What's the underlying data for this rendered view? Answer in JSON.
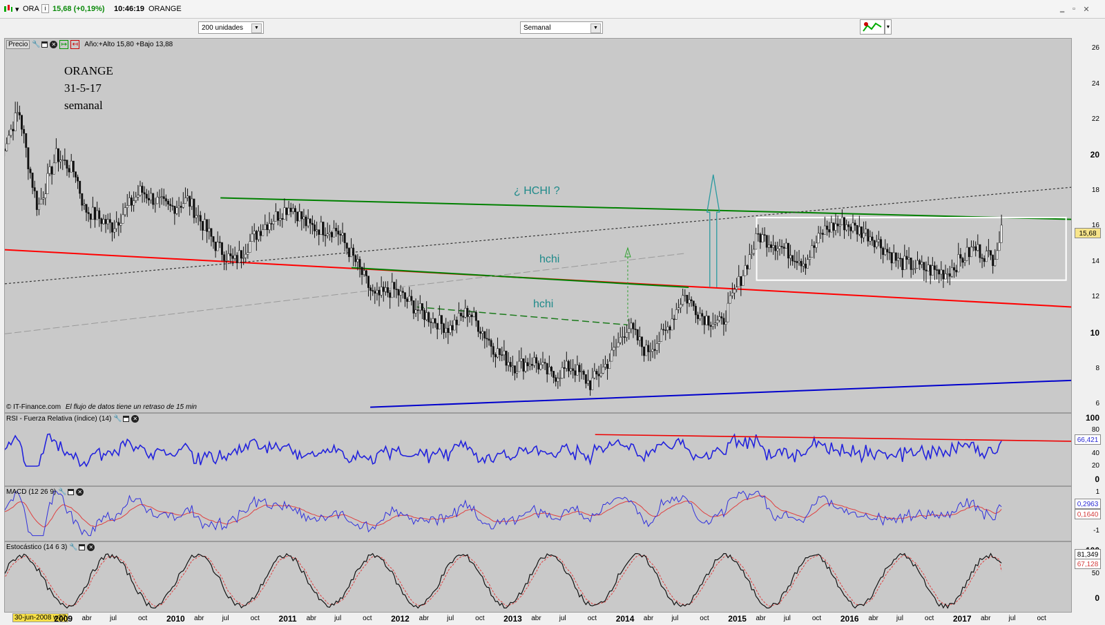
{
  "titlebar": {
    "symbol": "ORA",
    "info_icon": "i",
    "quote": "15,68 (+0,19%)",
    "time": "10:46:19",
    "name": "ORANGE",
    "quote_color": "#0b8a0b"
  },
  "toolbar": {
    "units_select": "200 unidades",
    "period_select": "Semanal"
  },
  "price_panel": {
    "label": "Precio",
    "year_info": "Año:+Alto 15,80 +Bajo 13,88",
    "note_lines": [
      "ORANGE",
      "31-5-17",
      "semanal"
    ],
    "annotations": {
      "hchi_question": "¿ HCHI ?",
      "hchi_upper": "hchi",
      "hchi_lower": "hchi"
    },
    "copyright": "© IT-Finance.com",
    "delay_note": "El flujo de datos tiene un retraso de 15 min",
    "axis_ticks": [
      "26",
      "24",
      "22",
      "20",
      "18",
      "16",
      "14",
      "12",
      "10",
      "8",
      "6"
    ],
    "current_price": "15,68"
  },
  "rsi_panel": {
    "label": "RSI - Fuerza Relativa (índice) (14)",
    "axis_ticks": [
      "100",
      "80",
      "60",
      "40",
      "20",
      "0"
    ],
    "current_value": "66,421"
  },
  "macd_panel": {
    "label": "MACD (12 26 9)",
    "axis_ticks": [
      "1",
      "0",
      "-1"
    ],
    "macd_value": "0,2963",
    "signal_value": "0,1640"
  },
  "stoch_panel": {
    "label": "Estocástico (14 6 3)",
    "axis_ticks": [
      "100",
      "50",
      "0"
    ],
    "k_value": "81,349",
    "d_value": "67,128"
  },
  "time_axis": {
    "cursor_date": "30-jun-2008 w27",
    "labels": [
      "2009",
      "abr",
      "jul",
      "oct",
      "2010",
      "abr",
      "jul",
      "oct",
      "2011",
      "abr",
      "jul",
      "oct",
      "2012",
      "abr",
      "jul",
      "oct",
      "2013",
      "abr",
      "jul",
      "oct",
      "2014",
      "abr",
      "jul",
      "oct",
      "2015",
      "abr",
      "jul",
      "oct",
      "2016",
      "abr",
      "jul",
      "oct",
      "2017",
      "abr",
      "jul",
      "oct"
    ]
  },
  "chart_data": {
    "type": "candlestick",
    "symbol": "ORANGE",
    "period": "semanal",
    "ylim": [
      6,
      26
    ],
    "x_range": [
      "2008-06-30",
      "2017-12-31"
    ],
    "price_path": [
      [
        "2008-06",
        20.0
      ],
      [
        "2008-08",
        22.5
      ],
      [
        "2008-09",
        19.5
      ],
      [
        "2008-10",
        17.0
      ],
      [
        "2008-12",
        20.0
      ],
      [
        "2009-02",
        19.0
      ],
      [
        "2009-03",
        17.0
      ],
      [
        "2009-06",
        16.0
      ],
      [
        "2009-09",
        18.0
      ],
      [
        "2009-12",
        17.0
      ],
      [
        "2010-02",
        17.5
      ],
      [
        "2010-05",
        15.0
      ],
      [
        "2010-07",
        14.0
      ],
      [
        "2010-10",
        16.0
      ],
      [
        "2011-01",
        17.2
      ],
      [
        "2011-03",
        16.0
      ],
      [
        "2011-06",
        15.8
      ],
      [
        "2011-08",
        14.0
      ],
      [
        "2011-10",
        12.0
      ],
      [
        "2011-12",
        12.5
      ],
      [
        "2012-03",
        11.2
      ],
      [
        "2012-06",
        10.3
      ],
      [
        "2012-08",
        11.3
      ],
      [
        "2012-11",
        9.0
      ],
      [
        "2013-01",
        8.2
      ],
      [
        "2013-03",
        8.5
      ],
      [
        "2013-05",
        7.6
      ],
      [
        "2013-07",
        8.2
      ],
      [
        "2013-09",
        7.2
      ],
      [
        "2013-11",
        8.5
      ],
      [
        "2014-01",
        10.5
      ],
      [
        "2014-03",
        9.0
      ],
      [
        "2014-05",
        10.0
      ],
      [
        "2014-07",
        12.2
      ],
      [
        "2014-09",
        11.0
      ],
      [
        "2014-11",
        10.5
      ],
      [
        "2015-01",
        13.0
      ],
      [
        "2015-03",
        15.5
      ],
      [
        "2015-05",
        15.0
      ],
      [
        "2015-08",
        14.0
      ],
      [
        "2015-10",
        15.8
      ],
      [
        "2015-12",
        16.2
      ],
      [
        "2016-03",
        15.5
      ],
      [
        "2016-06",
        14.0
      ],
      [
        "2016-09",
        13.6
      ],
      [
        "2016-11",
        13.4
      ],
      [
        "2017-02",
        14.8
      ],
      [
        "2017-04",
        14.2
      ],
      [
        "2017-05",
        15.68
      ]
    ],
    "trend_lines": [
      {
        "color": "#ff0000",
        "from": [
          "2008-06-30",
          14.7
        ],
        "to": [
          "2017-12-31",
          11.5
        ]
      },
      {
        "color": "#008000",
        "from": [
          "2010-06-01",
          17.6
        ],
        "to": [
          "2017-12-31",
          16.4
        ]
      },
      {
        "color": "#008000",
        "from": [
          "2011-08-01",
          13.7
        ],
        "to": [
          "2014-08-01",
          12.6
        ]
      },
      {
        "color": "#0000cc",
        "from": [
          "2011-10-01",
          5.9
        ],
        "to": [
          "2017-12-31",
          7.4
        ]
      }
    ],
    "rectangle": {
      "x": [
        "2015-03",
        "2017-12"
      ],
      "y": [
        13.0,
        16.5
      ]
    },
    "rsi_last": 66.421,
    "macd_last": 0.2963,
    "signal_last": 0.164,
    "stoch_k_last": 81.349,
    "stoch_d_last": 67.128
  }
}
